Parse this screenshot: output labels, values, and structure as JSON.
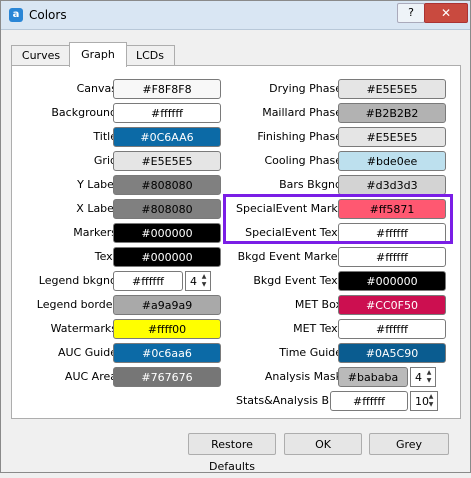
{
  "window": {
    "title": "Colors",
    "help_label": "?",
    "close_label": "✕",
    "app_icon": "a"
  },
  "tabs": [
    {
      "label": "Curves"
    },
    {
      "label": "Graph"
    },
    {
      "label": "LCDs"
    }
  ],
  "left_rows": [
    {
      "label": "Canvas",
      "value": "#F8F8F8",
      "bg": "#F8F8F8",
      "fg": "#000000"
    },
    {
      "label": "Background",
      "value": "#ffffff",
      "bg": "#ffffff",
      "fg": "#000000"
    },
    {
      "label": "Title",
      "value": "#0C6AA6",
      "bg": "#0C6AA6",
      "fg": "#ffffff"
    },
    {
      "label": "Grid",
      "value": "#E5E5E5",
      "bg": "#E5E5E5",
      "fg": "#000000"
    },
    {
      "label": "Y Label",
      "value": "#808080",
      "bg": "#808080",
      "fg": "#000000"
    },
    {
      "label": "X Label",
      "value": "#808080",
      "bg": "#808080",
      "fg": "#000000"
    },
    {
      "label": "Markers",
      "value": "#000000",
      "bg": "#000000",
      "fg": "#ffffff"
    },
    {
      "label": "Text",
      "value": "#000000",
      "bg": "#000000",
      "fg": "#ffffff"
    },
    {
      "label": "Legend bkgnd",
      "value": "#ffffff",
      "bg": "#ffffff",
      "fg": "#000000",
      "spin": "4"
    },
    {
      "label": "Legend border",
      "value": "#a9a9a9",
      "bg": "#a9a9a9",
      "fg": "#000000"
    },
    {
      "label": "Watermarks",
      "value": "#ffff00",
      "bg": "#ffff00",
      "fg": "#000000"
    },
    {
      "label": "AUC Guide",
      "value": "#0c6aa6",
      "bg": "#0c6aa6",
      "fg": "#ffffff"
    },
    {
      "label": "AUC Area",
      "value": "#767676",
      "bg": "#767676",
      "fg": "#ffffff"
    }
  ],
  "right_rows": [
    {
      "label": "Drying Phase",
      "value": "#E5E5E5",
      "bg": "#E5E5E5",
      "fg": "#000000"
    },
    {
      "label": "Maillard Phase",
      "value": "#B2B2B2",
      "bg": "#B2B2B2",
      "fg": "#000000"
    },
    {
      "label": "Finishing Phase",
      "value": "#E5E5E5",
      "bg": "#E5E5E5",
      "fg": "#000000"
    },
    {
      "label": "Cooling Phase",
      "value": "#bde0ee",
      "bg": "#bde0ee",
      "fg": "#000000"
    },
    {
      "label": "Bars Bkgnd",
      "value": "#d3d3d3",
      "bg": "#d3d3d3",
      "fg": "#000000"
    },
    {
      "label": "SpecialEvent Marker",
      "value": "#ff5871",
      "bg": "#ff5871",
      "fg": "#000000"
    },
    {
      "label": "SpecialEvent Text",
      "value": "#ffffff",
      "bg": "#ffffff",
      "fg": "#000000"
    },
    {
      "label": "Bkgd Event Marker",
      "value": "#ffffff",
      "bg": "#ffffff",
      "fg": "#000000"
    },
    {
      "label": "Bkgd Event Text",
      "value": "#000000",
      "bg": "#000000",
      "fg": "#ffffff"
    },
    {
      "label": "MET Box",
      "value": "#CC0F50",
      "bg": "#CC0F50",
      "fg": "#ffffff"
    },
    {
      "label": "MET Text",
      "value": "#ffffff",
      "bg": "#ffffff",
      "fg": "#000000"
    },
    {
      "label": "Time Guide",
      "value": "#0A5C90",
      "bg": "#0A5C90",
      "fg": "#ffffff"
    },
    {
      "label": "Analysis Mask",
      "value": "#bababa",
      "bg": "#bababa",
      "fg": "#000000",
      "spin": "4"
    },
    {
      "label": "Stats&Analysis Bkgnd",
      "value": "#ffffff",
      "bg": "#ffffff",
      "fg": "#000000",
      "spin": "10"
    }
  ],
  "buttons": {
    "restore_defaults": "Restore Defaults",
    "ok": "OK",
    "grey": "Grey"
  },
  "colors": {
    "highlight": "#7a1ee6"
  }
}
